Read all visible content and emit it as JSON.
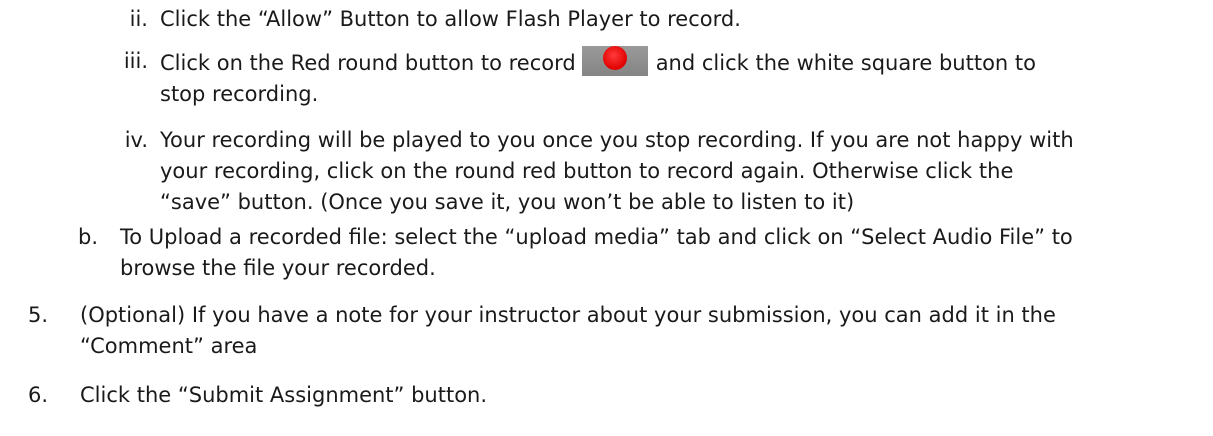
{
  "steps": [
    {
      "marker": "ii.",
      "lines": [
        "Click the “Allow” Button to allow Flash Player to record."
      ]
    },
    {
      "marker": "iii.",
      "line1_before": "Click on the Red round button to record",
      "line1_after": "and click the white square button to",
      "lines": [
        "stop recording."
      ]
    },
    {
      "marker": "iv.",
      "lines": [
        "Your recording will be played to you once you stop recording. If you are not happy with",
        "your recording, click on the round red button to record again. Otherwise click the",
        "“save” button. (Once you save it, you won’t be able to listen to it)"
      ]
    },
    {
      "marker": "b.",
      "lines": [
        "To Upload a recorded file: select the “upload media” tab and click on “Select Audio File” to",
        "browse the file your recorded."
      ]
    },
    {
      "marker": "5.",
      "lines": [
        "(Optional) If you have a note for your instructor about your submission, you can add it in the",
        "“Comment” area"
      ]
    },
    {
      "marker": "6.",
      "lines": [
        "Click the “Submit Assignment” button."
      ]
    }
  ],
  "icons": {
    "record_button": "record-button-icon",
    "record_color": "#ff0000",
    "record_bg": "#8c8c8c"
  }
}
